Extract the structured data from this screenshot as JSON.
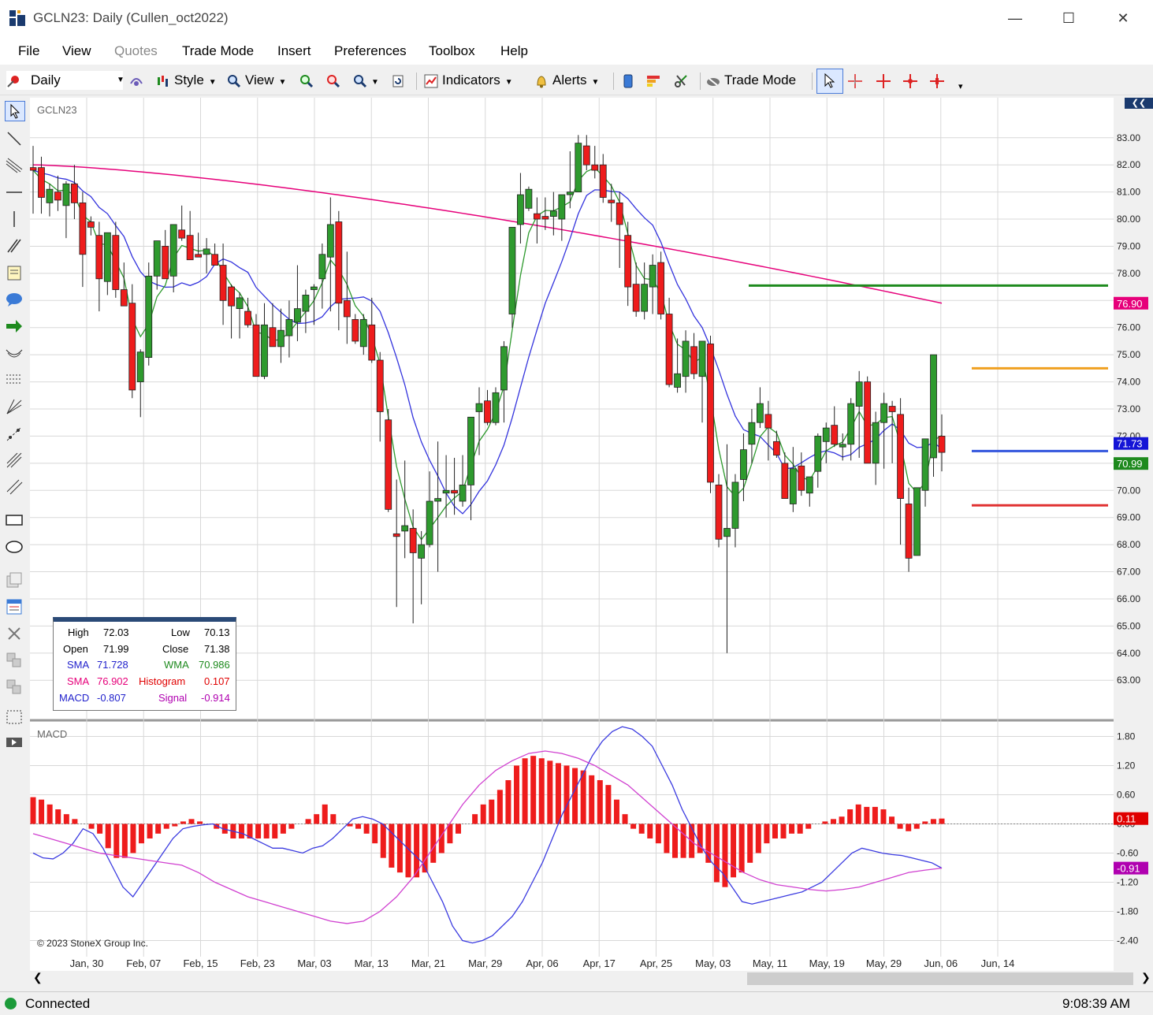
{
  "window": {
    "title": "GCLN23: Daily (Cullen_oct2022)",
    "minimize": "—",
    "maximize": "☐",
    "close": "✕"
  },
  "menu": [
    "File",
    "View",
    "Quotes",
    "Trade Mode",
    "Insert",
    "Preferences",
    "Toolbox",
    "Help"
  ],
  "toolbar": {
    "interval": "Daily",
    "style": "Style",
    "view": "View",
    "indicators": "Indicators",
    "alerts": "Alerts",
    "trade_mode": "Trade Mode"
  },
  "chart": {
    "symbol_label": "GCLN23",
    "macd_label": "MACD",
    "copyright": "© 2023 StoneX Group Inc.",
    "x_ticks": [
      "Jan, 30",
      "Feb, 07",
      "Feb, 15",
      "Feb, 23",
      "Mar, 03",
      "Mar, 13",
      "Mar, 21",
      "Mar, 29",
      "Apr, 06",
      "Apr, 17",
      "Apr, 25",
      "May, 03",
      "May, 11",
      "May, 19",
      "May, 29",
      "Jun, 06",
      "Jun, 14"
    ],
    "price_ticks": [
      "83.00",
      "82.00",
      "81.00",
      "80.00",
      "79.00",
      "78.00",
      "77.00",
      "76.00",
      "75.00",
      "74.00",
      "73.00",
      "72.00",
      "71.00",
      "70.00",
      "69.00",
      "68.00",
      "67.00",
      "66.00",
      "65.00",
      "64.00",
      "63.00"
    ],
    "macd_ticks": [
      "1.80",
      "1.20",
      "0.60",
      "0.00",
      "-0.60",
      "-1.20",
      "-1.80",
      "-2.40"
    ],
    "price_badges": [
      {
        "text": "76.90",
        "color": "#e6007a",
        "price": 76.9
      },
      {
        "text": "71.73",
        "color": "#1414d6",
        "price": 71.73
      },
      {
        "text": "70.99",
        "color": "#1e8a1e",
        "price": 70.99
      }
    ],
    "macd_badges": [
      {
        "text": "0.11",
        "color": "#e00000",
        "value": 0.11
      },
      {
        "text": "-0.91",
        "color": "#b000b0",
        "value": -0.91
      }
    ],
    "horizontal_lines": [
      {
        "color": "#1e8a1e",
        "price": 77.55
      },
      {
        "color": "#f0a020",
        "price": 74.5
      },
      {
        "color": "#3355dd",
        "price": 71.45
      },
      {
        "color": "#e03030",
        "price": 69.45
      }
    ]
  },
  "info_box": {
    "high_label": "High",
    "high": "72.03",
    "low_label": "Low",
    "low": "70.13",
    "open_label": "Open",
    "open": "71.99",
    "close_label": "Close",
    "close": "71.38",
    "sma1_label": "SMA",
    "sma1": "71.728",
    "wma_label": "WMA",
    "wma": "70.986",
    "sma2_label": "SMA",
    "sma2": "76.902",
    "hist_label": "Histogram",
    "hist": "0.107",
    "macd_label": "MACD",
    "macd": "-0.807",
    "signal_label": "Signal",
    "signal": "-0.914"
  },
  "status": {
    "connection": "Connected",
    "time": "9:08:39 AM"
  },
  "chart_data": {
    "type": "candlestick",
    "ohlc": [
      [
        81.9,
        82.7,
        80.2,
        81.8
      ],
      [
        81.9,
        82.3,
        80.2,
        80.8
      ],
      [
        80.6,
        81.3,
        80.1,
        81.1
      ],
      [
        81.0,
        81.6,
        80.3,
        80.7
      ],
      [
        80.5,
        81.4,
        79.3,
        81.3
      ],
      [
        81.3,
        82.0,
        80.0,
        80.6
      ],
      [
        80.6,
        81.0,
        77.5,
        78.7
      ],
      [
        79.9,
        80.1,
        79.4,
        79.7
      ],
      [
        79.4,
        79.9,
        76.6,
        77.8
      ],
      [
        77.7,
        79.3,
        77.2,
        79.5
      ],
      [
        79.4,
        79.9,
        77.1,
        77.4
      ],
      [
        77.4,
        78.4,
        76.8,
        76.8
      ],
      [
        76.9,
        77.6,
        73.4,
        73.7
      ],
      [
        74.0,
        75.2,
        72.7,
        75.1
      ],
      [
        74.9,
        78.4,
        74.6,
        77.9
      ],
      [
        77.9,
        79.1,
        77.4,
        79.2
      ],
      [
        79.0,
        79.6,
        77.9,
        77.8
      ],
      [
        77.9,
        79.2,
        77.3,
        79.8
      ],
      [
        79.6,
        80.5,
        79.2,
        79.3
      ],
      [
        79.4,
        80.3,
        78.6,
        78.5
      ],
      [
        78.7,
        79.5,
        78.6,
        78.6
      ],
      [
        78.7,
        79.3,
        78.0,
        78.9
      ],
      [
        78.7,
        79.1,
        78.3,
        78.3
      ],
      [
        78.3,
        79.1,
        76.1,
        77.0
      ],
      [
        77.5,
        77.6,
        75.6,
        76.8
      ],
      [
        76.7,
        77.3,
        75.6,
        77.1
      ],
      [
        76.6,
        77.1,
        76.0,
        76.1
      ],
      [
        76.1,
        76.5,
        74.2,
        74.2
      ],
      [
        74.2,
        76.9,
        74.1,
        76.1
      ],
      [
        76.0,
        76.9,
        75.5,
        75.3
      ],
      [
        75.3,
        76.7,
        74.7,
        75.9
      ],
      [
        75.7,
        77.0,
        74.9,
        76.3
      ],
      [
        76.2,
        78.3,
        75.5,
        76.7
      ],
      [
        76.6,
        77.4,
        75.8,
        77.2
      ],
      [
        77.4,
        77.6,
        76.1,
        77.5
      ],
      [
        77.8,
        79.1,
        76.7,
        78.7
      ],
      [
        78.6,
        80.8,
        76.6,
        79.8
      ],
      [
        79.9,
        80.3,
        75.9,
        76.9
      ],
      [
        77.0,
        78.8,
        75.4,
        76.4
      ],
      [
        76.3,
        76.5,
        75.4,
        75.5
      ],
      [
        75.3,
        76.5,
        75.0,
        76.3
      ],
      [
        76.1,
        77.1,
        74.7,
        74.8
      ],
      [
        74.8,
        75.1,
        71.8,
        72.9
      ],
      [
        72.6,
        73.0,
        69.2,
        69.3
      ],
      [
        68.4,
        70.4,
        65.7,
        68.3
      ],
      [
        68.5,
        71.1,
        67.5,
        68.7
      ],
      [
        68.6,
        69.3,
        65.1,
        67.7
      ],
      [
        67.5,
        68.5,
        65.8,
        68.0
      ],
      [
        68.0,
        70.7,
        67.9,
        69.6
      ],
      [
        69.6,
        71.8,
        67.0,
        69.7
      ],
      [
        69.9,
        71.3,
        69.0,
        70.0
      ],
      [
        70.0,
        71.2,
        69.1,
        69.9
      ],
      [
        69.6,
        71.3,
        69.4,
        70.2
      ],
      [
        70.2,
        72.6,
        68.9,
        72.7
      ],
      [
        72.9,
        73.8,
        71.3,
        73.2
      ],
      [
        73.3,
        73.7,
        72.4,
        72.5
      ],
      [
        72.5,
        73.8,
        72.4,
        73.6
      ],
      [
        73.7,
        75.5,
        72.5,
        75.3
      ],
      [
        76.5,
        79.0,
        76.0,
        79.7
      ],
      [
        79.8,
        81.7,
        79.1,
        80.9
      ],
      [
        80.4,
        81.2,
        80.3,
        81.1
      ],
      [
        80.2,
        80.8,
        79.1,
        80.0
      ],
      [
        80.1,
        80.8,
        79.6,
        80.0
      ],
      [
        80.1,
        81.0,
        79.4,
        80.3
      ],
      [
        80.0,
        80.8,
        79.2,
        80.9
      ],
      [
        80.9,
        82.5,
        80.4,
        81.0
      ],
      [
        81.0,
        83.1,
        81.7,
        82.8
      ],
      [
        82.7,
        83.1,
        81.8,
        82.0
      ],
      [
        82.0,
        82.7,
        81.5,
        81.8
      ],
      [
        82.0,
        82.4,
        80.6,
        80.8
      ],
      [
        80.7,
        81.3,
        79.9,
        80.6
      ],
      [
        80.6,
        81.0,
        78.2,
        79.8
      ],
      [
        79.4,
        79.9,
        76.8,
        77.5
      ],
      [
        77.6,
        78.4,
        76.4,
        76.6
      ],
      [
        76.6,
        78.4,
        76.3,
        77.6
      ],
      [
        77.5,
        78.7,
        76.5,
        78.3
      ],
      [
        78.4,
        78.8,
        76.3,
        76.5
      ],
      [
        76.5,
        77.1,
        73.8,
        73.9
      ],
      [
        73.8,
        75.6,
        73.6,
        74.3
      ],
      [
        74.2,
        75.9,
        73.6,
        75.5
      ],
      [
        75.3,
        75.8,
        74.1,
        74.3
      ],
      [
        74.2,
        75.5,
        72.5,
        75.5
      ],
      [
        75.4,
        75.7,
        69.9,
        70.3
      ],
      [
        70.2,
        70.6,
        67.9,
        68.2
      ],
      [
        68.3,
        71.7,
        64.0,
        68.6
      ],
      [
        68.6,
        70.6,
        67.9,
        70.3
      ],
      [
        70.4,
        72.1,
        69.6,
        71.5
      ],
      [
        71.7,
        73.0,
        71.0,
        72.5
      ],
      [
        72.5,
        73.8,
        72.3,
        73.2
      ],
      [
        72.8,
        73.3,
        71.1,
        72.3
      ],
      [
        71.8,
        72.2,
        71.2,
        71.3
      ],
      [
        71.0,
        71.4,
        69.7,
        69.7
      ],
      [
        69.5,
        71.6,
        69.2,
        70.8
      ],
      [
        70.9,
        71.4,
        69.8,
        70.0
      ],
      [
        69.9,
        70.5,
        69.4,
        70.5
      ],
      [
        70.7,
        72.1,
        70.1,
        72.0
      ],
      [
        71.8,
        72.5,
        71.0,
        72.3
      ],
      [
        72.4,
        73.1,
        71.6,
        71.7
      ],
      [
        71.6,
        72.1,
        71.1,
        71.7
      ],
      [
        71.7,
        73.4,
        71.1,
        73.2
      ],
      [
        73.1,
        74.4,
        71.2,
        74.0
      ],
      [
        74.0,
        74.2,
        71.0,
        71.0
      ],
      [
        71.0,
        72.9,
        70.2,
        72.5
      ],
      [
        72.5,
        73.6,
        70.8,
        73.2
      ],
      [
        73.1,
        73.3,
        71.0,
        72.9
      ],
      [
        72.8,
        73.4,
        68.0,
        69.7
      ],
      [
        69.5,
        70.1,
        67.0,
        67.5
      ],
      [
        67.6,
        70.1,
        67.6,
        70.1
      ],
      [
        70.0,
        71.3,
        69.4,
        71.9
      ],
      [
        71.2,
        72.7,
        70.5,
        75.0
      ],
      [
        72.0,
        72.8,
        70.7,
        71.4
      ]
    ],
    "sma_short": {
      "name": "SMA",
      "color": "#3333dd",
      "value": 71.728
    },
    "wma": {
      "name": "WMA",
      "color": "#2e9a2e",
      "value": 70.986
    },
    "sma_long": {
      "name": "SMA",
      "color": "#e6007a",
      "value": 76.902
    },
    "y_range": [
      62.6,
      83.4
    ],
    "macd": {
      "hist": [
        0.55,
        0.5,
        0.4,
        0.3,
        0.2,
        0.1,
        0.0,
        -0.1,
        -0.2,
        -0.5,
        -0.7,
        -0.7,
        -0.6,
        -0.4,
        -0.3,
        -0.2,
        -0.1,
        -0.05,
        0.05,
        0.1,
        0.05,
        0.0,
        -0.1,
        -0.2,
        -0.3,
        -0.3,
        -0.3,
        -0.3,
        -0.3,
        -0.3,
        -0.2,
        -0.1,
        0.0,
        0.1,
        0.2,
        0.4,
        0.2,
        0.0,
        -0.05,
        -0.1,
        -0.2,
        -0.4,
        -0.7,
        -0.9,
        -1.0,
        -1.1,
        -1.1,
        -1.0,
        -0.8,
        -0.6,
        -0.4,
        -0.2,
        0.0,
        0.2,
        0.4,
        0.5,
        0.7,
        0.9,
        1.2,
        1.35,
        1.4,
        1.35,
        1.3,
        1.25,
        1.2,
        1.15,
        1.1,
        1.0,
        0.9,
        0.8,
        0.5,
        0.2,
        -0.1,
        -0.2,
        -0.3,
        -0.4,
        -0.6,
        -0.7,
        -0.7,
        -0.7,
        -0.6,
        -0.8,
        -1.2,
        -1.3,
        -1.1,
        -1.0,
        -0.8,
        -0.6,
        -0.4,
        -0.3,
        -0.3,
        -0.2,
        -0.2,
        -0.1,
        0.0,
        0.05,
        0.1,
        0.15,
        0.3,
        0.4,
        0.35,
        0.35,
        0.3,
        0.15,
        -0.1,
        -0.15,
        -0.1,
        0.05,
        0.1,
        0.11
      ],
      "macd_line": [
        -0.6,
        -0.7,
        -0.72,
        -0.6,
        -0.4,
        -0.1,
        -0.2,
        -0.5,
        -0.9,
        -1.3,
        -1.5,
        -1.2,
        -0.9,
        -0.6,
        -0.3,
        -0.1,
        -0.05,
        -0.02,
        0.0,
        -0.1,
        -0.15,
        -0.2,
        -0.3,
        -0.4,
        -0.5,
        -0.5,
        -0.55,
        -0.6,
        -0.5,
        -0.45,
        -0.3,
        -0.1,
        0.1,
        0.15,
        0.1,
        0.0,
        -0.2,
        -0.4,
        -0.6,
        -0.8,
        -1.2,
        -1.6,
        -2.1,
        -2.4,
        -2.45,
        -2.4,
        -2.3,
        -2.1,
        -1.9,
        -1.6,
        -1.2,
        -0.8,
        -0.3,
        0.2,
        0.6,
        1.0,
        1.4,
        1.7,
        1.9,
        2.0,
        1.95,
        1.8,
        1.6,
        1.2,
        0.8,
        0.3,
        -0.1,
        -0.5,
        -0.8,
        -1.0,
        -1.3,
        -1.6,
        -1.65,
        -1.6,
        -1.55,
        -1.5,
        -1.45,
        -1.4,
        -1.3,
        -1.2,
        -1.0,
        -0.8,
        -0.6,
        -0.5,
        -0.55,
        -0.6,
        -0.63,
        -0.65,
        -0.7,
        -0.75,
        -0.8,
        -0.91
      ],
      "signal_line": [
        -0.2,
        -0.3,
        -0.4,
        -0.5,
        -0.6,
        -0.65,
        -0.7,
        -0.75,
        -0.8,
        -0.85,
        -1.0,
        -1.2,
        -1.35,
        -1.5,
        -1.6,
        -1.7,
        -1.8,
        -1.9,
        -2.0,
        -2.05,
        -2.0,
        -1.8,
        -1.5,
        -1.1,
        -0.6,
        -0.1,
        0.4,
        0.8,
        1.1,
        1.3,
        1.45,
        1.5,
        1.45,
        1.35,
        1.2,
        1.0,
        0.8,
        0.5,
        0.2,
        -0.1,
        -0.4,
        -0.6,
        -0.8,
        -1.0,
        -1.15,
        -1.25,
        -1.3,
        -1.35,
        -1.38,
        -1.35,
        -1.3,
        -1.2,
        -1.1,
        -1.0,
        -0.95,
        -0.91
      ],
      "y_range": [
        -2.7,
        2.1
      ]
    }
  }
}
